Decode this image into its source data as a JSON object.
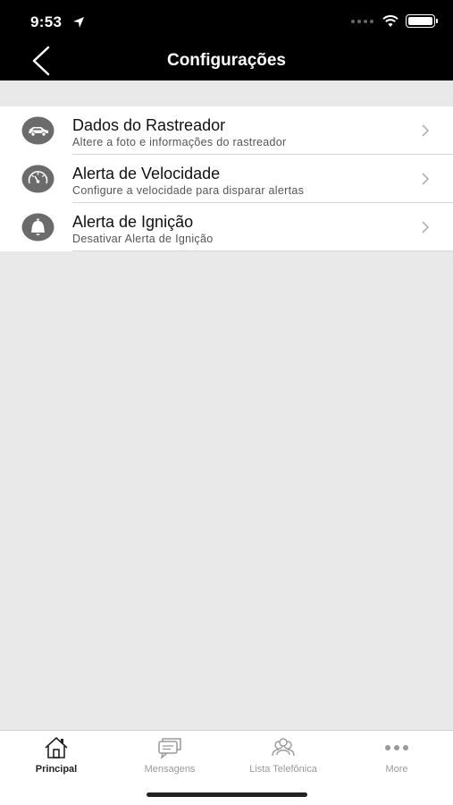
{
  "status_bar": {
    "time": "9:53"
  },
  "nav": {
    "title": "Configurações",
    "back_icon": "chevron-left-icon"
  },
  "settings": [
    {
      "title": "Dados do Rastreador",
      "subtitle": "Altere a foto e informações do rastreador",
      "icon": "car-icon"
    },
    {
      "title": "Alerta de Velocidade",
      "subtitle": "Configure a velocidade para disparar alertas",
      "icon": "speedometer-icon"
    },
    {
      "title": "Alerta de Ignição",
      "subtitle": "Desativar Alerta de Ignição",
      "icon": "bell-icon"
    }
  ],
  "tabs": [
    {
      "label": "Principal",
      "icon": "home-icon",
      "active": true
    },
    {
      "label": "Mensagens",
      "icon": "messages-icon",
      "active": false
    },
    {
      "label": "Lista Telefônica",
      "icon": "contacts-icon",
      "active": false
    },
    {
      "label": "More",
      "icon": "more-icon",
      "active": false
    }
  ],
  "colors": {
    "nav_bg": "#000000",
    "icon_circle": "#6b6b6b",
    "background": "#e9e9e9",
    "active_tab": "#222222",
    "inactive_tab": "#9a9a9a"
  }
}
